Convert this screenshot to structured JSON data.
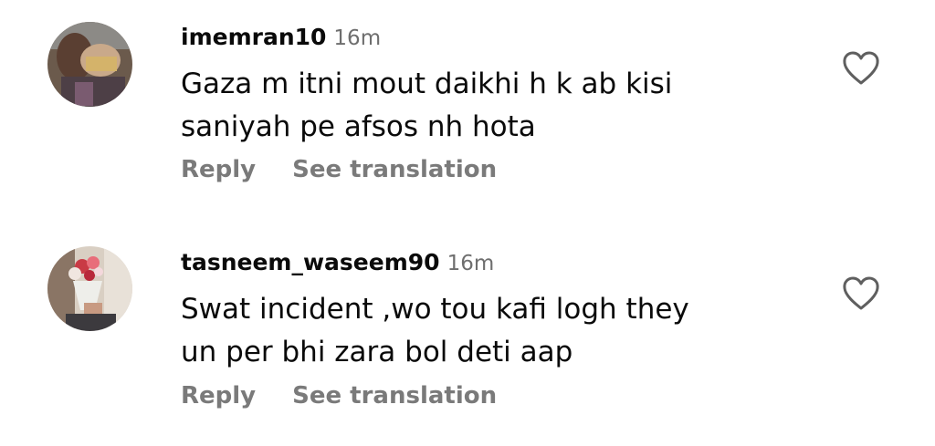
{
  "comments": [
    {
      "username": "imemran10",
      "time": "16m",
      "text": "Gaza m itni mout daikhi h k ab kisi\nsaniyah pe afsos nh hota",
      "reply_label": "Reply",
      "translate_label": "See translation",
      "like_icon": "heart-outline-icon"
    },
    {
      "username": "tasneem_waseem90",
      "time": "16m",
      "text": "Swat incident ,wo tou kafi logh they\nun per bhi zara bol deti aap",
      "reply_label": "Reply",
      "translate_label": "See translation",
      "like_icon": "heart-outline-icon"
    }
  ]
}
